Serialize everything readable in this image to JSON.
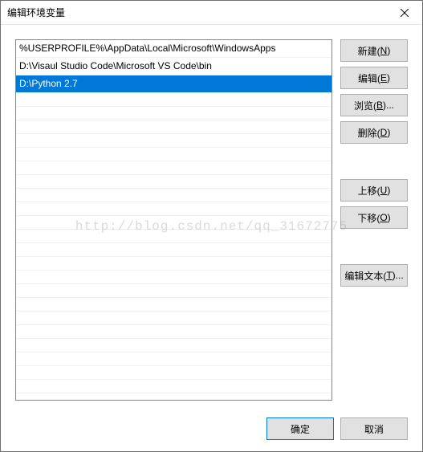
{
  "window": {
    "title": "编辑环境变量"
  },
  "list": {
    "items": [
      {
        "text": "%USERPROFILE%\\AppData\\Local\\Microsoft\\WindowsApps",
        "selected": false
      },
      {
        "text": "D:\\Visaul Studio Code\\Microsoft VS Code\\bin",
        "selected": false
      },
      {
        "text": "D:\\Python 2.7",
        "selected": true
      }
    ]
  },
  "buttons": {
    "new": {
      "label": "新建(",
      "key": "N",
      "suffix": ")"
    },
    "edit": {
      "label": "编辑(",
      "key": "E",
      "suffix": ")"
    },
    "browse": {
      "label": "浏览(",
      "key": "B",
      "suffix": ")..."
    },
    "delete": {
      "label": "删除(",
      "key": "D",
      "suffix": ")"
    },
    "moveup": {
      "label": "上移(",
      "key": "U",
      "suffix": ")"
    },
    "movedown": {
      "label": "下移(",
      "key": "O",
      "suffix": ")"
    },
    "edittext": {
      "label": "编辑文本(",
      "key": "T",
      "suffix": ")..."
    }
  },
  "footer": {
    "ok": "确定",
    "cancel": "取消"
  },
  "watermark": "http://blog.csdn.net/qq_31672775"
}
